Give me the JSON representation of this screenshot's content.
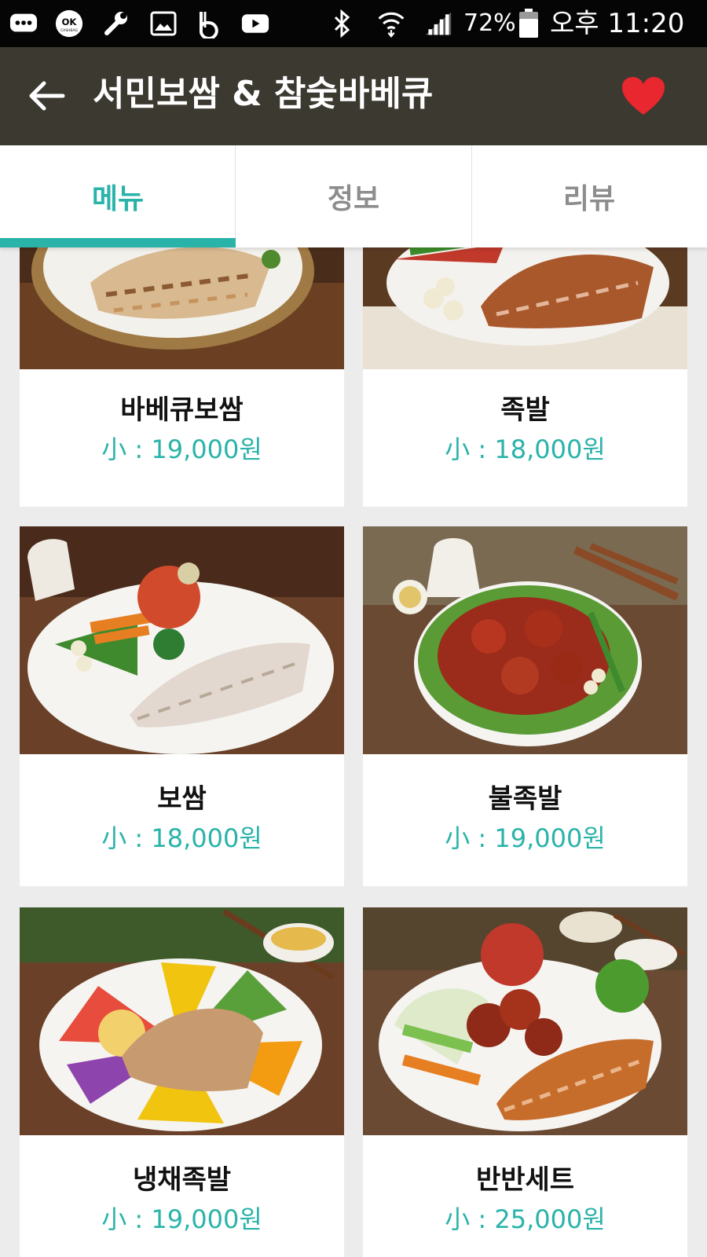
{
  "status_bar": {
    "battery": "72%",
    "time": "오후 11:20",
    "icons": [
      "message-icon",
      "ok-cashbag-icon",
      "wrench-icon",
      "gallery-icon",
      "b-app-icon",
      "youtube-icon",
      "bluetooth-icon",
      "wifi-icon",
      "signal-icon",
      "battery-icon"
    ]
  },
  "app_bar": {
    "title": "서민보쌈 & 참숯바베큐",
    "back_icon": "arrow-left-icon",
    "favorite_icon": "heart-icon",
    "favorite_color": "#e8272f"
  },
  "tabs": [
    {
      "label": "메뉴",
      "active": true
    },
    {
      "label": "정보",
      "active": false
    },
    {
      "label": "리뷰",
      "active": false
    }
  ],
  "colors": {
    "accent": "#2ab3a9",
    "app_bar_bg": "#3b3930",
    "status_bar_bg": "#050505",
    "page_bg": "#ececec"
  },
  "menu": [
    {
      "name": "바베큐보쌈",
      "price": "小 : 19,000원"
    },
    {
      "name": "족발",
      "price": "小 : 18,000원"
    },
    {
      "name": "보쌈",
      "price": "小 : 18,000원"
    },
    {
      "name": "불족발",
      "price": "小 : 19,000원"
    },
    {
      "name": "냉채족발",
      "price": "小 : 19,000원"
    },
    {
      "name": "반반세트",
      "price": "小 : 25,000원"
    }
  ]
}
